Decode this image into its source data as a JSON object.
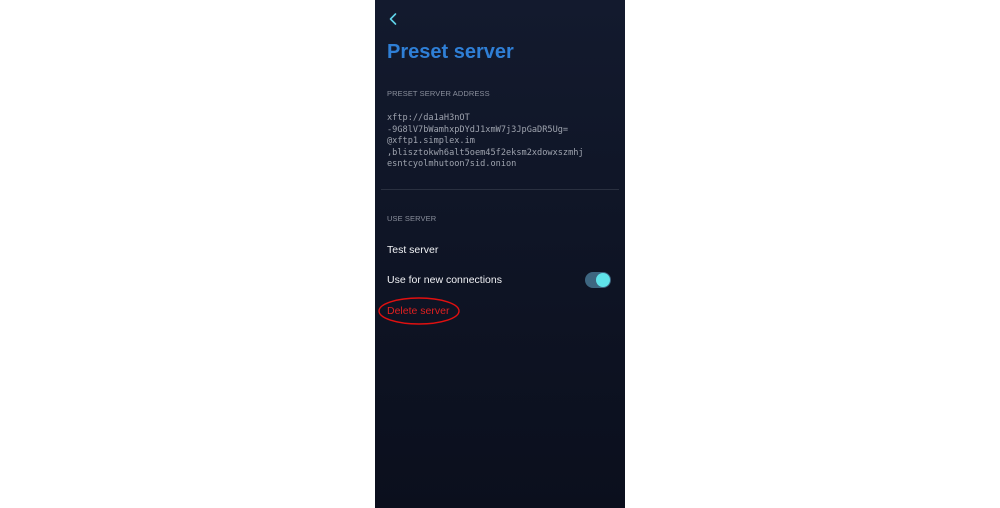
{
  "header": {
    "back_icon": "chevron-left-icon",
    "title": "Preset server"
  },
  "address_section": {
    "label": "PRESET SERVER ADDRESS",
    "lines": [
      "xftp://da1aH3nOT",
      "-9G8lV7bWamhxpDYdJ1xmW7j3JpGaDR5Ug=",
      "@xftp1.simplex.im",
      ",bliszt​okwh6alt5oem45f2eksm2xdowxszmhj",
      "esntcyolmhutoon7sid.onion"
    ]
  },
  "use_section": {
    "label": "USE SERVER",
    "test_label": "Test server",
    "use_new_label": "Use for new connections",
    "use_new_enabled": true,
    "delete_label": "Delete server"
  },
  "colors": {
    "title": "#2f7fd6",
    "background": "#0f1526",
    "toggle_track": "#3d6680",
    "toggle_knob": "#5fe3ea",
    "delete": "#e02020",
    "annotation": "#e01010"
  }
}
